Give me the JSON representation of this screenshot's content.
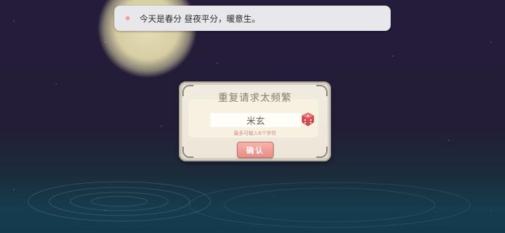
{
  "banner": {
    "message": "今天是春分 昼夜平分，暖意生。"
  },
  "dialog": {
    "title": "重复请求太频繁",
    "name_value": "米玄",
    "hint": "最多可输入6个字符",
    "confirm_label": "确认"
  },
  "colors": {
    "sky": "#241c3a",
    "moon": "#d7cea4",
    "dialog_bg": "#f1ece1",
    "title_text": "#8b7a69",
    "hint_text": "#d48a8a",
    "confirm_bg": "#f0a09a",
    "dice": "#d94a52"
  },
  "icons": {
    "randomize": "dice-icon",
    "bullet": "dot-icon"
  }
}
